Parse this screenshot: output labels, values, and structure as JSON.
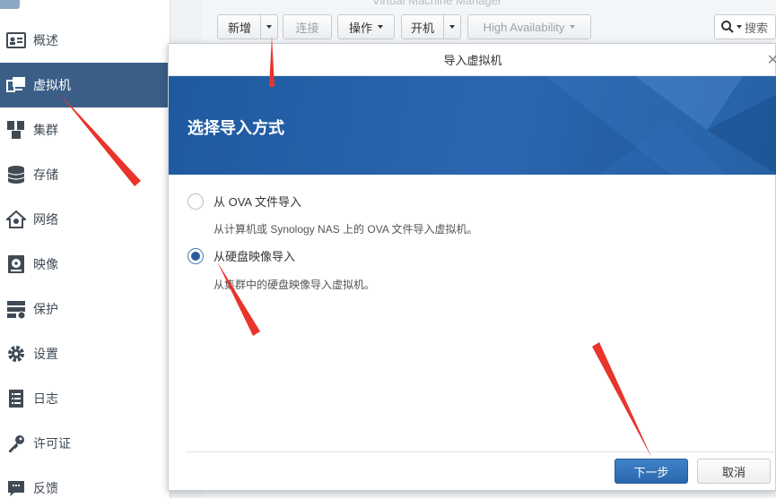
{
  "app": {
    "window_title": "Virtual Machine Manager"
  },
  "sidebar": {
    "items": [
      {
        "label": "概述",
        "icon": "overview-icon"
      },
      {
        "label": "虚拟机",
        "icon": "virtual-machine-icon",
        "active": true
      },
      {
        "label": "集群",
        "icon": "cluster-icon"
      },
      {
        "label": "存储",
        "icon": "storage-icon"
      },
      {
        "label": "网络",
        "icon": "network-icon"
      },
      {
        "label": "映像",
        "icon": "image-icon"
      },
      {
        "label": "保护",
        "icon": "protection-icon"
      },
      {
        "label": "设置",
        "icon": "settings-icon"
      },
      {
        "label": "日志",
        "icon": "log-icon"
      },
      {
        "label": "许可证",
        "icon": "license-icon"
      },
      {
        "label": "反馈",
        "icon": "feedback-icon"
      }
    ]
  },
  "toolbar": {
    "create": "新增",
    "connect": "连接",
    "action": "操作",
    "power_on": "开机",
    "high_availability": "High Availability",
    "search": "搜索"
  },
  "modal": {
    "title": "导入虚拟机",
    "heading": "选择导入方式",
    "options": [
      {
        "label": "从 OVA 文件导入",
        "description": "从计算机或 Synology NAS 上的 OVA 文件导入虚拟机。",
        "selected": false
      },
      {
        "label": "从硬盘映像导入",
        "description": "从集群中的硬盘映像导入虚拟机。",
        "selected": true
      }
    ],
    "next": "下一步",
    "cancel": "取消"
  },
  "colors": {
    "sidebar_active": "#3b5e87",
    "banner": "#2a67b0",
    "primary_button": "#2f72ba",
    "annotation_arrow": "#e8342a"
  }
}
